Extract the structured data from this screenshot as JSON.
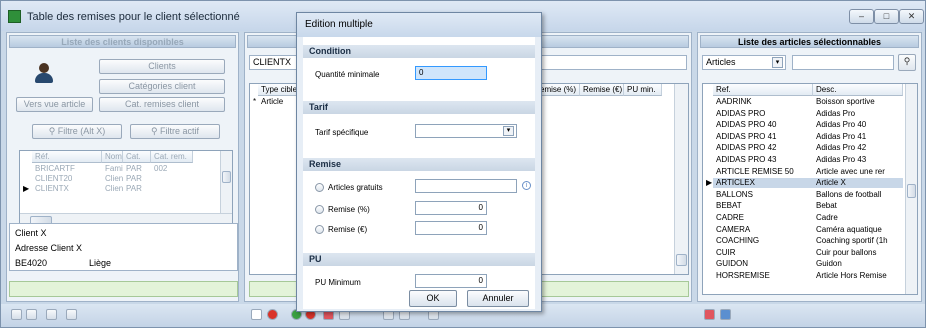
{
  "window": {
    "title": "Table des remises pour le client sélectionné",
    "controls": [
      "–",
      "□",
      "✕"
    ]
  },
  "left": {
    "header": "Liste des clients disponibles",
    "btn_clients": "Clients",
    "btn_categories": "Catégories client",
    "btn_vers": "Vers vue article",
    "btn_cat_remises": "Cat. remises client",
    "btn_filtre": "Filtre (Alt X)",
    "btn_filtre_actif": "Filtre actif",
    "table": {
      "headers": [
        "Réf.",
        "Nom",
        "Cat.",
        "Cat. rem."
      ],
      "rows": [
        [
          "BRICARTF",
          "Fami",
          "PAR",
          "002"
        ],
        [
          "CLIENT20",
          "Client",
          "PAR",
          ""
        ],
        [
          "CLIENTX",
          "Client",
          "PAR",
          ""
        ]
      ]
    },
    "info": [
      "Client X",
      "Adresse Client X",
      "BE4020",
      "Liège"
    ]
  },
  "middle": {
    "client_field": "CLIENTX",
    "headers": [
      "Type cible",
      "emise (%)",
      "Remise (€)",
      "PU min."
    ],
    "row_type": "Article"
  },
  "right": {
    "header": "Liste des articles sélectionnables",
    "combo_value": "Articles",
    "headers": [
      "Ref.",
      "Desc."
    ],
    "rows": [
      [
        "AADRINK",
        "Boisson sportive"
      ],
      [
        "ADIDAS PRO",
        "Adidas Pro"
      ],
      [
        "ADIDAS PRO 40",
        "Adidas Pro 40"
      ],
      [
        "ADIDAS PRO 41",
        "Adidas Pro 41"
      ],
      [
        "ADIDAS PRO 42",
        "Adidas Pro 42"
      ],
      [
        "ADIDAS PRO 43",
        "Adidas Pro 43"
      ],
      [
        "ARTICLE REMISE 50",
        "Article avec une rer"
      ],
      [
        "ARTICLEX",
        "Article X"
      ],
      [
        "BALLONS",
        "Ballons de football"
      ],
      [
        "BEBAT",
        "Bebat"
      ],
      [
        "CADRE",
        "Cadre"
      ],
      [
        "CAMERA",
        "Caméra aquatique"
      ],
      [
        "COACHING",
        "Coaching sportif (1h"
      ],
      [
        "CUIR",
        "Cuir pour ballons"
      ],
      [
        "GUIDON",
        "Guidon"
      ],
      [
        "HORSREMISE",
        "Article Hors Remise"
      ]
    ],
    "selected_index": 7
  },
  "dialog": {
    "title": "Edition multiple",
    "sec_condition": "Condition",
    "qty_label": "Quantité minimale",
    "qty_value": "0",
    "sec_tarif": "Tarif",
    "tarif_label": "Tarif spécifique",
    "tarif_value": "",
    "sec_remise": "Remise",
    "r_gratuits": "Articles gratuits",
    "r_gratuits_value": "",
    "r_pct": "Remise (%)",
    "r_pct_value": "0",
    "r_eur": "Remise (€)",
    "r_eur_value": "0",
    "sec_pu": "PU",
    "pu_label": "PU Minimum",
    "pu_value": "0",
    "ok": "OK",
    "cancel": "Annuler"
  },
  "colors": {
    "accent": "#3399ff",
    "selected": "#c8d7e8"
  }
}
